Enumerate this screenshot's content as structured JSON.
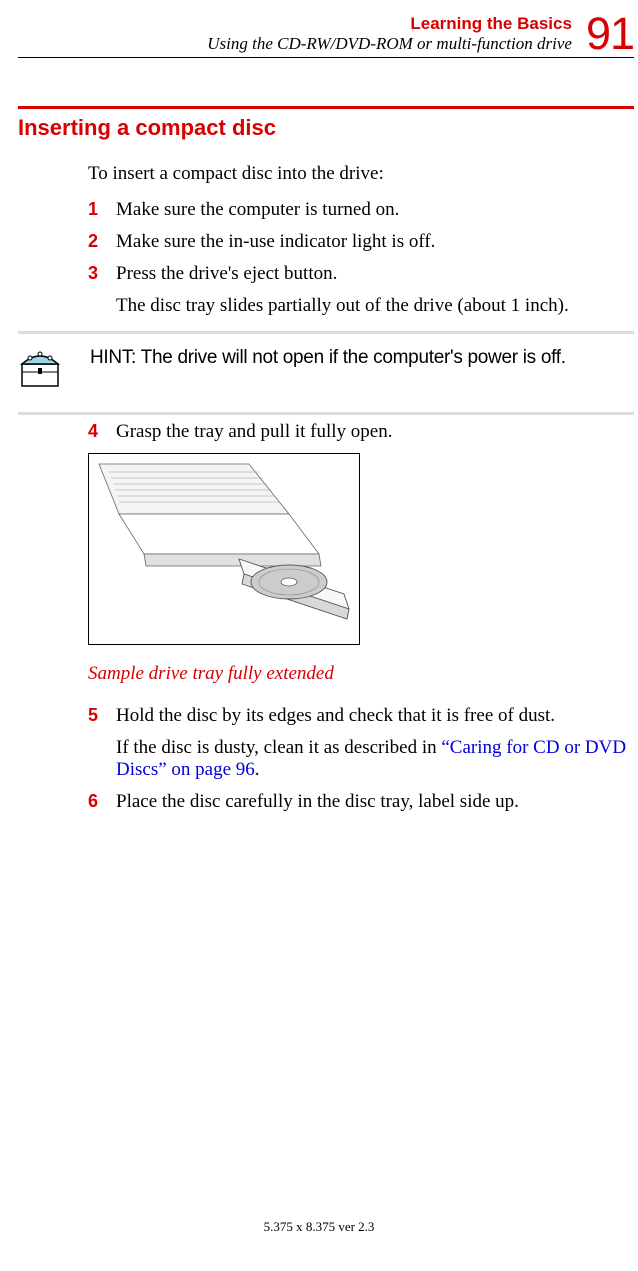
{
  "header": {
    "chapter": "Learning the Basics",
    "subchapter": "Using the CD-RW/DVD-ROM or multi-function drive",
    "page_number": "91"
  },
  "section": {
    "title": "Inserting a compact disc",
    "intro": "To insert a compact disc into the drive:"
  },
  "steps": {
    "s1": {
      "num": "1",
      "text": "Make sure the computer is turned on."
    },
    "s2": {
      "num": "2",
      "text": "Make sure the in-use indicator light is off."
    },
    "s3": {
      "num": "3",
      "text_a": "Press the drive's eject button.",
      "text_b": "The disc tray slides partially out of the drive (about 1 inch)."
    },
    "s4": {
      "num": "4",
      "text": "Grasp the tray and pull it fully open."
    },
    "s5": {
      "num": "5",
      "text_a": "Hold the disc by its edges and check that it is free of dust.",
      "text_b_pre": "If the disc is dusty, clean it as described in ",
      "link": "“Caring for CD or DVD Discs” on page 96",
      "text_b_post": "."
    },
    "s6": {
      "num": "6",
      "text": "Place the disc carefully in the disc tray, label side up."
    }
  },
  "hint": {
    "text": "HINT: The drive will not open if the computer's power is off."
  },
  "figure": {
    "caption": "Sample drive tray fully extended"
  },
  "footer": {
    "text": "5.375 x 8.375 ver 2.3"
  }
}
